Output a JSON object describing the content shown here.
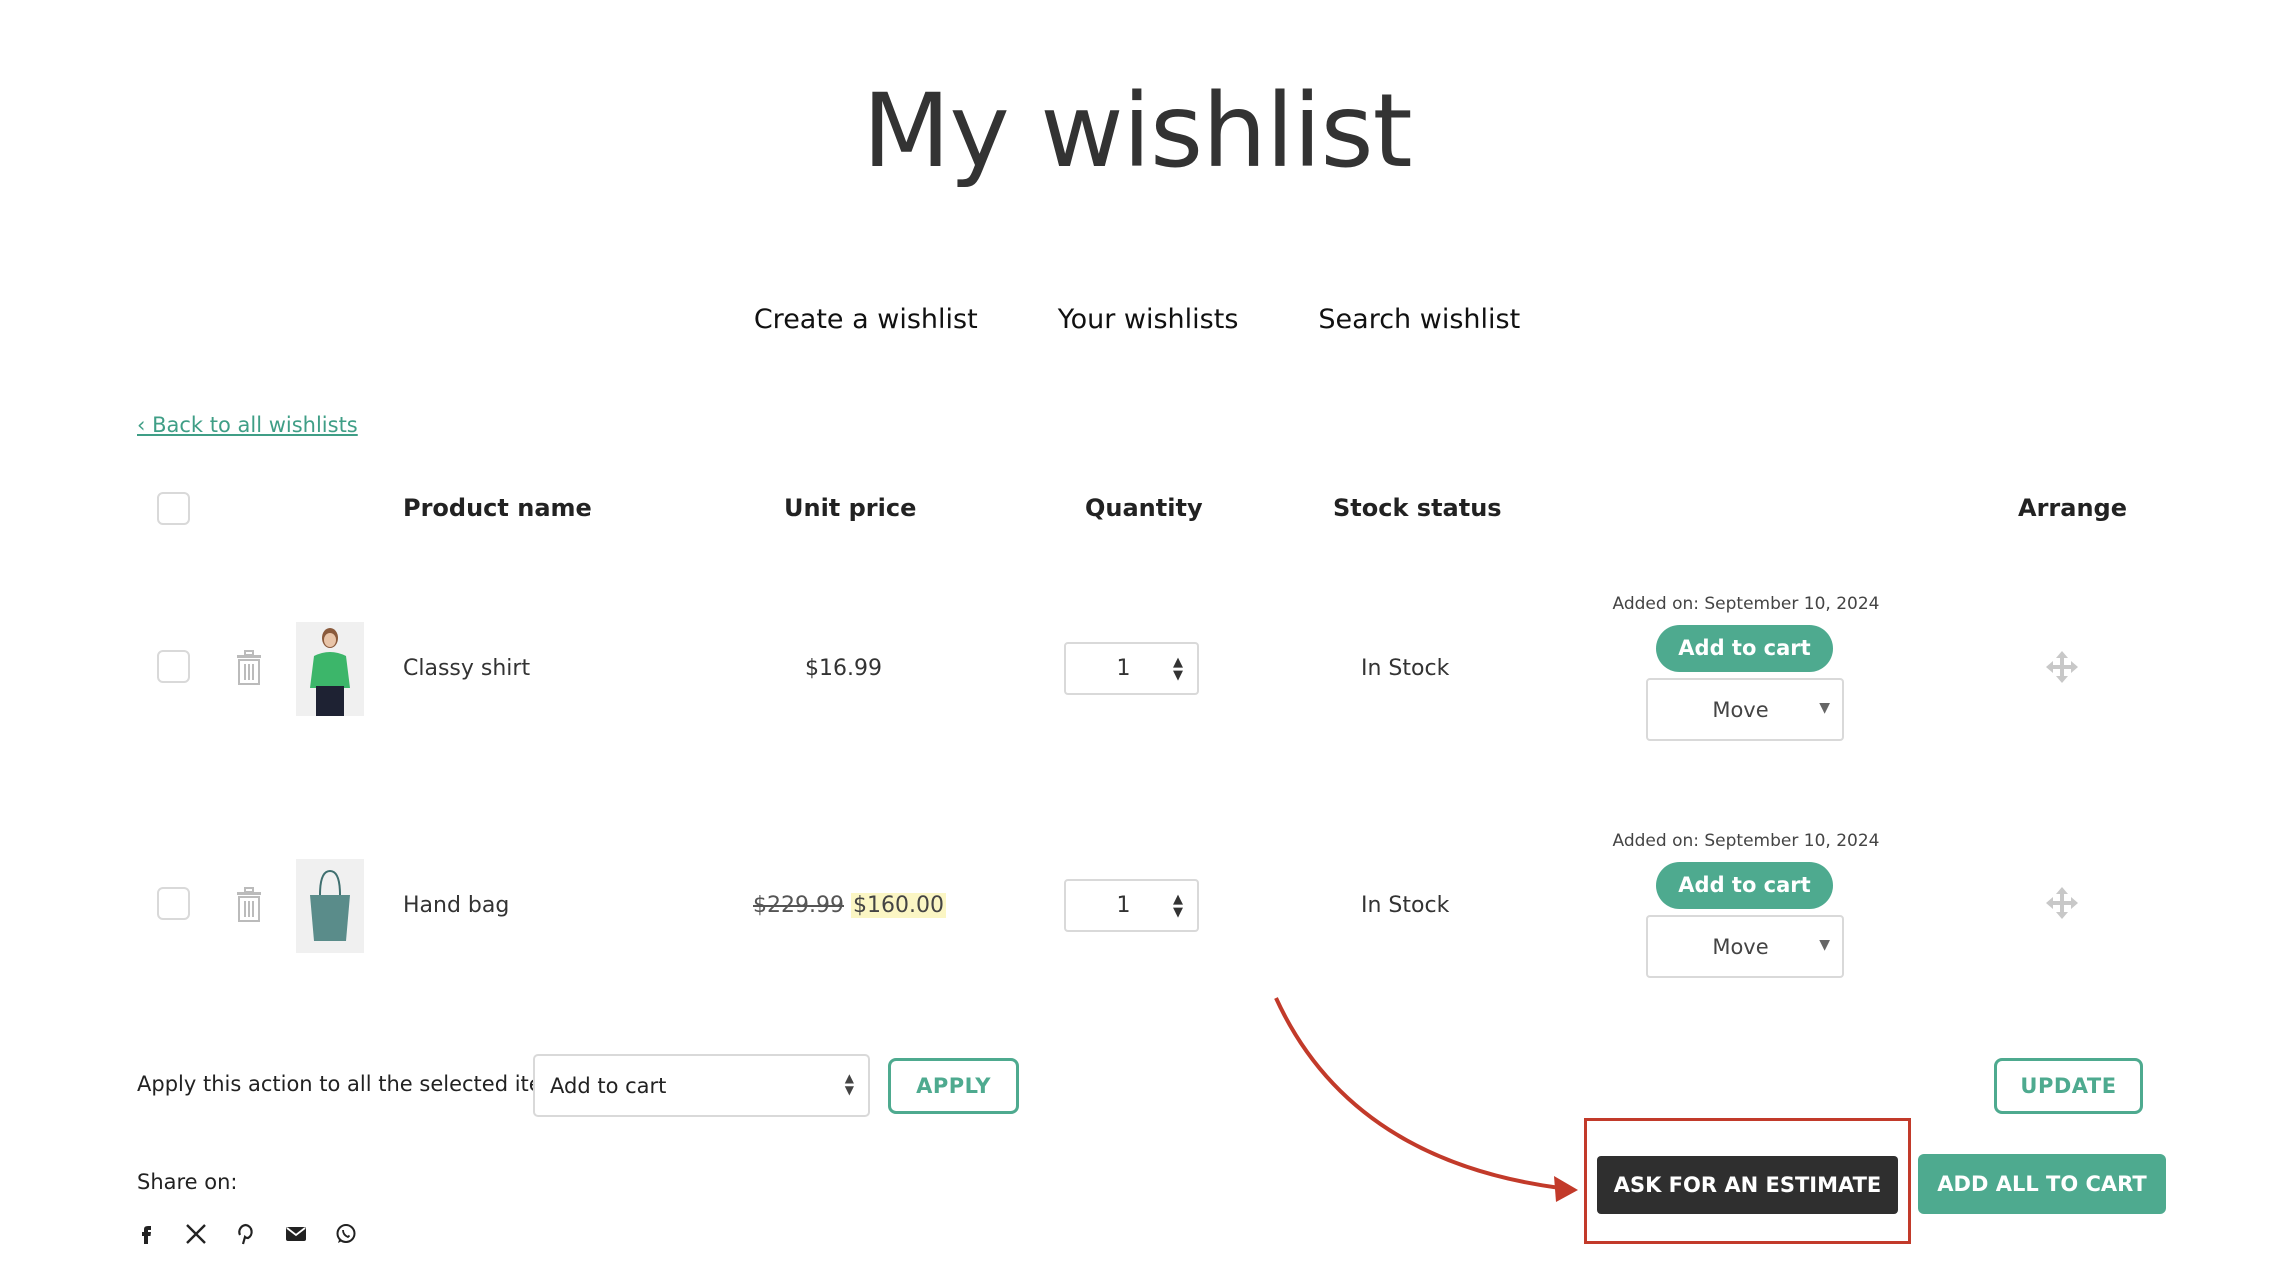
{
  "page": {
    "title": "My wishlist"
  },
  "nav": {
    "create": "Create a wishlist",
    "yours": "Your wishlists",
    "search": "Search wishlist"
  },
  "back_link": "‹ Back to all wishlists",
  "table": {
    "headers": {
      "product": "Product name",
      "price": "Unit price",
      "quantity": "Quantity",
      "stock": "Stock status",
      "arrange": "Arrange"
    },
    "rows": [
      {
        "name": "Classy shirt",
        "price": "$16.99",
        "quantity": "1",
        "stock": "In Stock",
        "added_on": "Added on: September 10, 2024",
        "add_to_cart": "Add to cart",
        "move": "Move"
      },
      {
        "name": "Hand bag",
        "old_price": "$229.99",
        "price": "$160.00",
        "quantity": "1",
        "stock": "In Stock",
        "added_on": "Added on: September 10, 2024",
        "add_to_cart": "Add to cart",
        "move": "Move"
      }
    ]
  },
  "bulk": {
    "label": "Apply this action to all the selected items:",
    "selected": "Add to cart",
    "apply": "APPLY"
  },
  "buttons": {
    "update": "UPDATE",
    "estimate": "ASK FOR AN ESTIMATE",
    "add_all": "ADD ALL TO CART"
  },
  "share": {
    "label": "Share on:",
    "icons": [
      "facebook-icon",
      "x-icon",
      "pinterest-icon",
      "email-icon",
      "whatsapp-icon"
    ]
  },
  "colors": {
    "accent": "#4eaa8f",
    "dark_button": "#2f2f2f",
    "highlight": "#c23a2a"
  }
}
